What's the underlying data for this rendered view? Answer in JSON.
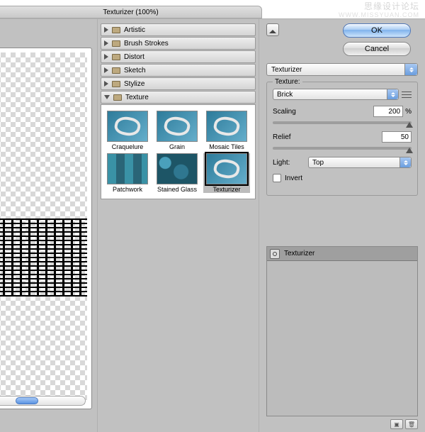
{
  "window": {
    "title": "Texturizer (100%)"
  },
  "watermark": {
    "main": "思缘设计论坛",
    "sub": "WWW.MISSYUAN.COM"
  },
  "buttons": {
    "ok": "OK",
    "cancel": "Cancel"
  },
  "filter_select": "Texturizer",
  "categories": [
    {
      "label": "Artistic",
      "open": false
    },
    {
      "label": "Brush Strokes",
      "open": false
    },
    {
      "label": "Distort",
      "open": false
    },
    {
      "label": "Sketch",
      "open": false
    },
    {
      "label": "Stylize",
      "open": false
    },
    {
      "label": "Texture",
      "open": true
    }
  ],
  "thumbs": [
    {
      "label": "Craquelure",
      "cls": ""
    },
    {
      "label": "Grain",
      "cls": ""
    },
    {
      "label": "Mosaic Tiles",
      "cls": ""
    },
    {
      "label": "Patchwork",
      "cls": "patch"
    },
    {
      "label": "Stained Glass",
      "cls": "sg"
    },
    {
      "label": "Texturizer",
      "cls": "",
      "selected": true
    }
  ],
  "options": {
    "group_label": "Texture:",
    "texture_value": "Brick",
    "scaling_label": "Scaling",
    "scaling_value": "200",
    "scaling_pct": "%",
    "relief_label": "Relief",
    "relief_value": "50",
    "light_label": "Light:",
    "light_value": "Top",
    "invert_label": "Invert"
  },
  "layers": {
    "item": "Texturizer"
  }
}
